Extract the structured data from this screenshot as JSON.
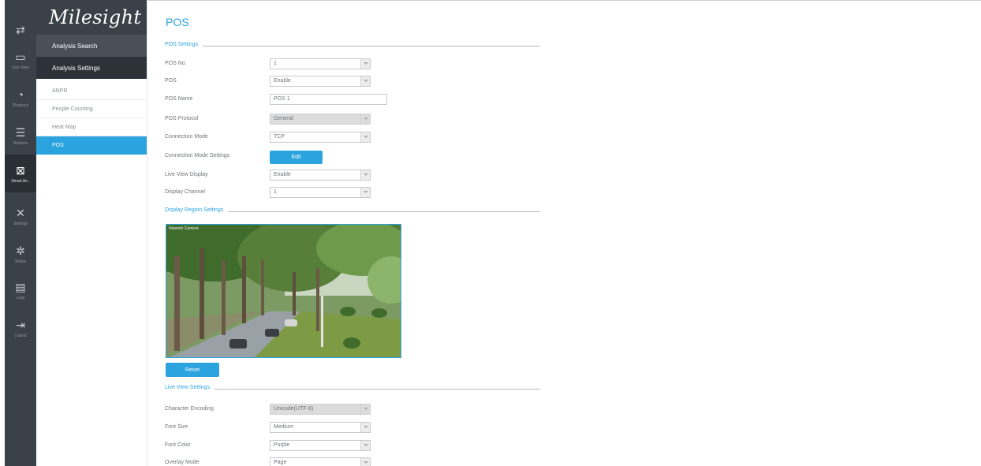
{
  "brand": {
    "logo_text": "Milesight"
  },
  "rail": {
    "items": [
      {
        "icon": "switch-icon",
        "glyph": "⇄",
        "label": ""
      },
      {
        "icon": "live-view-icon",
        "glyph": "▭",
        "label": "Live View"
      },
      {
        "icon": "playback-icon",
        "glyph": "◔",
        "label": "Playback"
      },
      {
        "icon": "retrieve-icon",
        "glyph": "☰",
        "label": "Retrieve"
      },
      {
        "icon": "smart-analysis-icon",
        "glyph": "⊠",
        "label": "Smart An.."
      },
      {
        "icon": "settings-icon",
        "glyph": "✕",
        "label": "Settings"
      },
      {
        "icon": "status-icon",
        "glyph": "✲",
        "label": "Status"
      },
      {
        "icon": "logs-icon",
        "glyph": "▤",
        "label": "Logs"
      },
      {
        "icon": "logout-icon",
        "glyph": "⇥",
        "label": "Logout"
      }
    ]
  },
  "menu": {
    "analysis_search": "Analysis Search",
    "analysis_settings": "Analysis Settings",
    "items": [
      "ANPR",
      "People Counting",
      "Heat Map",
      "POS"
    ]
  },
  "page": {
    "title": "POS",
    "pos_settings_title": "POS Settings",
    "display_region_title": "Display Region Settings",
    "live_view_settings_title": "Live View Settings"
  },
  "pos_settings": {
    "pos_no": {
      "label": "POS No.",
      "value": "1"
    },
    "pos": {
      "label": "POS",
      "value": "Enable"
    },
    "pos_name": {
      "label": "POS Name",
      "value": "POS 1"
    },
    "pos_protocol": {
      "label": "POS Protocol",
      "value": "General"
    },
    "connection_mode": {
      "label": "Connection Mode",
      "value": "TCP"
    },
    "connection_mode_settings": {
      "label": "Connection Mode Settings",
      "button": "Edit"
    },
    "live_view_display": {
      "label": "Live View Display",
      "value": "Enable"
    },
    "display_channel": {
      "label": "Display Channel",
      "value": "1"
    }
  },
  "display_region": {
    "osd_text": "Network Camera",
    "reset_button": "Reset"
  },
  "live_view_settings": {
    "character_encoding": {
      "label": "Character Encoding",
      "value": "Unicode(UTF-8)"
    },
    "font_size": {
      "label": "Font Size",
      "value": "Medium"
    },
    "font_color": {
      "label": "Font Color",
      "value": "Purple"
    },
    "overlay_mode": {
      "label": "Overlay Mode",
      "value": "Page"
    }
  },
  "colors": {
    "accent": "#2ba3df",
    "rail_bg": "#3b4148",
    "menu_dark": "#2d3238"
  }
}
